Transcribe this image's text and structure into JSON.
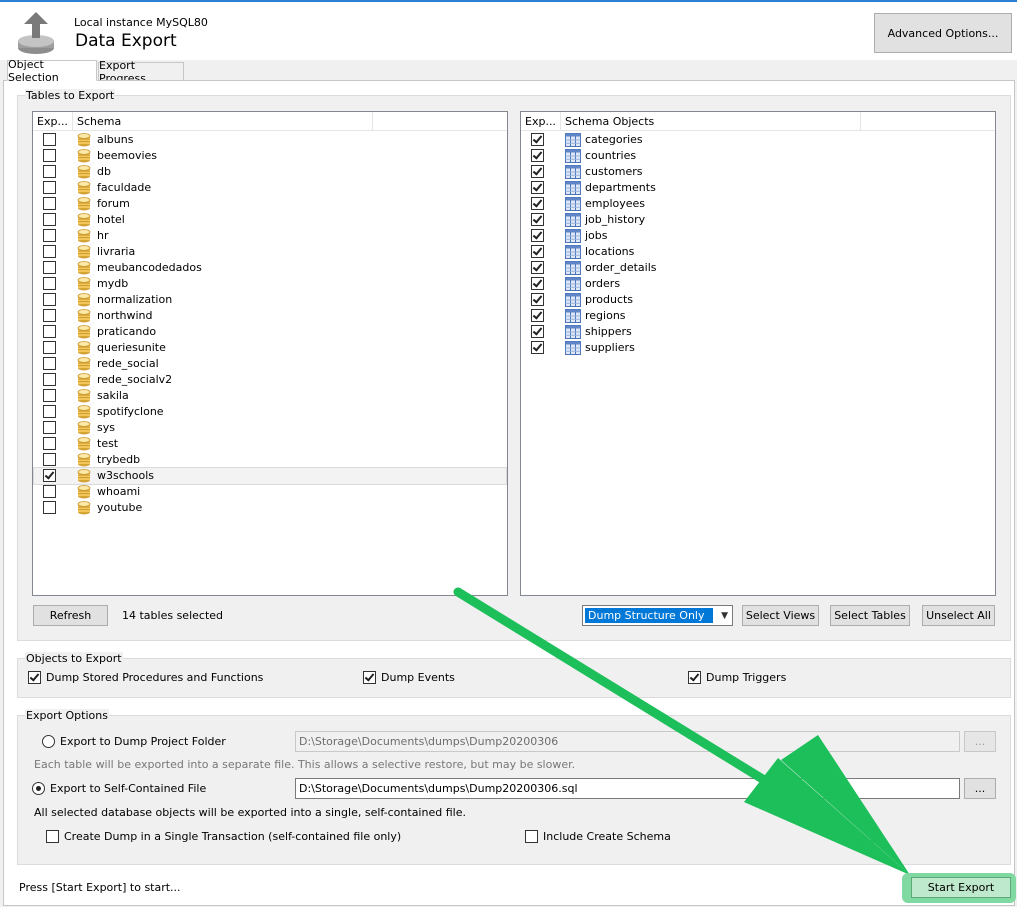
{
  "header": {
    "instance": "Local instance MySQL80",
    "title": "Data Export",
    "advanced_button": "Advanced Options..."
  },
  "tabs": [
    {
      "label": "Object Selection",
      "active": true
    },
    {
      "label": "Export Progress",
      "active": false
    }
  ],
  "tables_to_export": {
    "title": "Tables to Export",
    "schema_columns": [
      "Exp...",
      "Schema"
    ],
    "schemas": [
      {
        "name": "albuns",
        "checked": false
      },
      {
        "name": "beemovies",
        "checked": false
      },
      {
        "name": "db",
        "checked": false
      },
      {
        "name": "faculdade",
        "checked": false
      },
      {
        "name": "forum",
        "checked": false
      },
      {
        "name": "hotel",
        "checked": false
      },
      {
        "name": "hr",
        "checked": false
      },
      {
        "name": "livraria",
        "checked": false
      },
      {
        "name": "meubancodedados",
        "checked": false
      },
      {
        "name": "mydb",
        "checked": false
      },
      {
        "name": "normalization",
        "checked": false
      },
      {
        "name": "northwind",
        "checked": false
      },
      {
        "name": "praticando",
        "checked": false
      },
      {
        "name": "queriesunite",
        "checked": false
      },
      {
        "name": "rede_social",
        "checked": false
      },
      {
        "name": "rede_socialv2",
        "checked": false
      },
      {
        "name": "sakila",
        "checked": false
      },
      {
        "name": "spotifyclone",
        "checked": false
      },
      {
        "name": "sys",
        "checked": false
      },
      {
        "name": "test",
        "checked": false
      },
      {
        "name": "trybedb",
        "checked": false
      },
      {
        "name": "w3schools",
        "checked": true,
        "selected": true
      },
      {
        "name": "whoami",
        "checked": false
      },
      {
        "name": "youtube",
        "checked": false
      }
    ],
    "object_columns": [
      "Exp...",
      "Schema Objects"
    ],
    "objects": [
      {
        "name": "categories",
        "checked": true
      },
      {
        "name": "countries",
        "checked": true
      },
      {
        "name": "customers",
        "checked": true
      },
      {
        "name": "departments",
        "checked": true
      },
      {
        "name": "employees",
        "checked": true
      },
      {
        "name": "job_history",
        "checked": true
      },
      {
        "name": "jobs",
        "checked": true
      },
      {
        "name": "locations",
        "checked": true
      },
      {
        "name": "order_details",
        "checked": true
      },
      {
        "name": "orders",
        "checked": true
      },
      {
        "name": "products",
        "checked": true
      },
      {
        "name": "regions",
        "checked": true
      },
      {
        "name": "shippers",
        "checked": true
      },
      {
        "name": "suppliers",
        "checked": true
      }
    ],
    "refresh_button": "Refresh",
    "selected_count": "14 tables selected",
    "dump_mode": "Dump Structure Only",
    "select_views": "Select Views",
    "select_tables": "Select Tables",
    "unselect_all": "Unselect All"
  },
  "objects_to_export": {
    "title": "Objects to Export",
    "items": [
      {
        "label": "Dump Stored Procedures and Functions",
        "checked": true
      },
      {
        "label": "Dump Events",
        "checked": true
      },
      {
        "label": "Dump Triggers",
        "checked": true
      }
    ]
  },
  "export_options": {
    "title": "Export Options",
    "folder_radio": "Export to Dump Project Folder",
    "folder_path": "D:\\Storage\\Documents\\dumps\\Dump20200306",
    "folder_note": "Each table will be exported into a separate file. This allows a selective restore, but may be slower.",
    "file_radio": "Export to Self-Contained File",
    "file_path": "D:\\Storage\\Documents\\dumps\\Dump20200306.sql",
    "file_note": "All selected database objects will be exported into a single, self-contained file.",
    "browse": "...",
    "single_transaction": "Create Dump in a Single Transaction (self-contained file only)",
    "include_schema": "Include Create Schema",
    "selected_mode": "file"
  },
  "footer": {
    "status": "Press [Start Export] to start...",
    "start_button": "Start Export"
  },
  "colors": {
    "highlight": "#1dbf5a",
    "selection": "#0078d7"
  }
}
